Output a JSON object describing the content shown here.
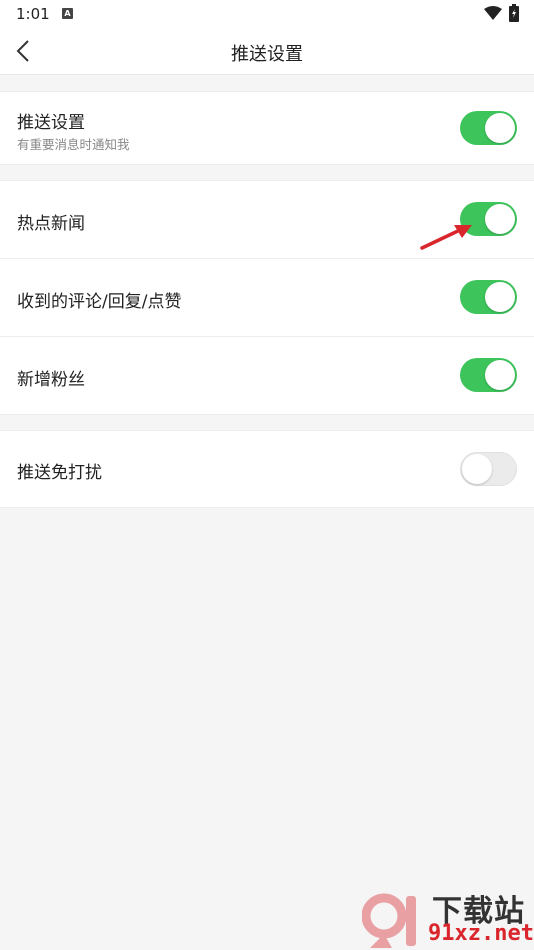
{
  "status_bar": {
    "time": "1:01",
    "notification_letter": "A"
  },
  "header": {
    "title": "推送设置",
    "back_icon": "chevron-left-icon"
  },
  "sections": [
    {
      "rows": [
        {
          "label": "推送设置",
          "sublabel": "有重要消息时通知我",
          "toggle_on": true
        }
      ]
    },
    {
      "rows": [
        {
          "label": "热点新闻",
          "toggle_on": true
        },
        {
          "label": "收到的评论/回复/点赞",
          "toggle_on": true
        },
        {
          "label": "新增粉丝",
          "toggle_on": true
        }
      ]
    },
    {
      "rows": [
        {
          "label": "推送免打扰",
          "toggle_on": false
        }
      ]
    }
  ],
  "colors": {
    "toggle_on": "#3dc45b",
    "toggle_off": "#ebebeb",
    "arrow": "#d9252b"
  },
  "watermark": {
    "brand_text": "下载站",
    "domain": "91xz.net"
  }
}
